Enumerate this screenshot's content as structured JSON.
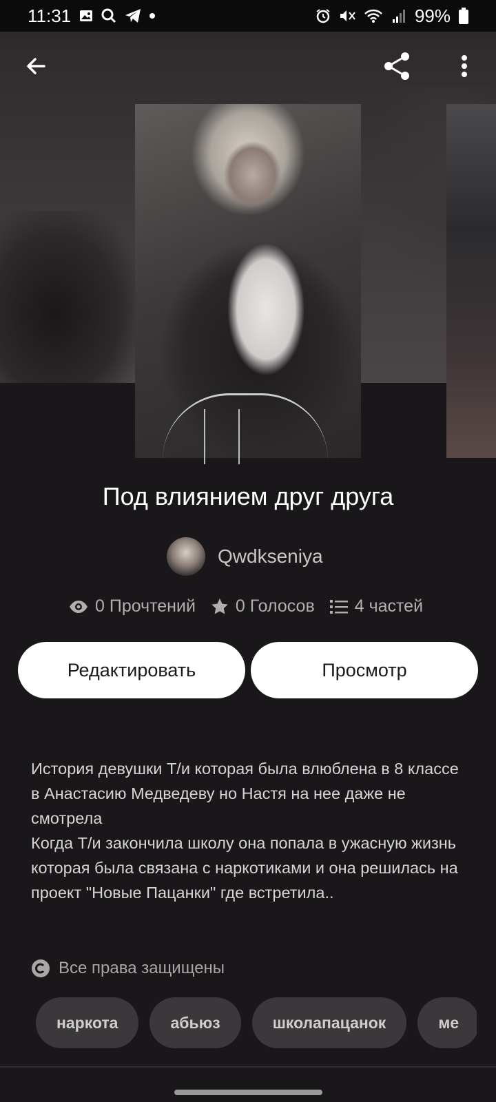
{
  "status_bar": {
    "time": "11:31",
    "battery": "99%"
  },
  "story": {
    "title": "Под влиянием друг друга",
    "author": "Qwdkseniya",
    "stats": {
      "reads": "0 Прочтений",
      "votes": "0 Голосов",
      "parts": "4 частей"
    }
  },
  "actions": {
    "edit_label": "Редактировать",
    "view_label": "Просмотр"
  },
  "description": {
    "paragraph1": "История девушки Т/и которая была влюблена в 8 классе в Анастасию Медведеву но Настя на нее даже не смотрела",
    "paragraph2": "Когда Т/и закончила школу она попала в ужасную жизнь которая была связана с наркотиками и она решилась на проект \"Новые Пацанки\" где встретила.."
  },
  "rights": {
    "label": "Все права защищены"
  },
  "tags": [
    "наркота",
    "абьюз",
    "школапацанок",
    "ме"
  ]
}
